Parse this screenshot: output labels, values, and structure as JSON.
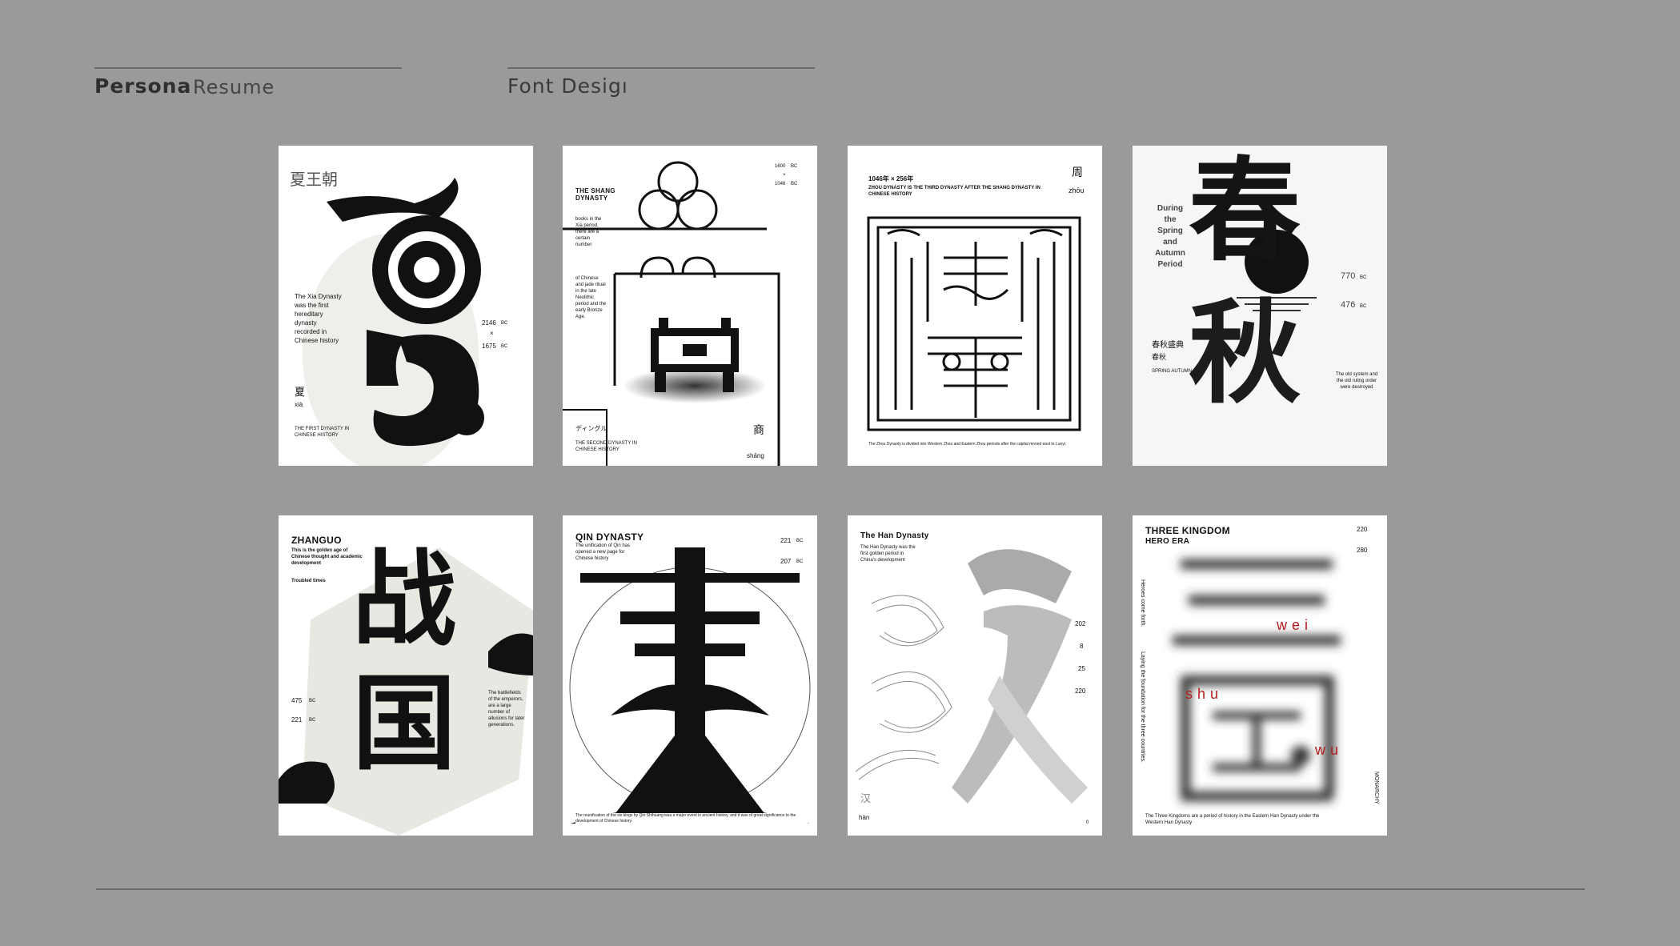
{
  "header": {
    "nav_persona": "Persona",
    "nav_resume": "Resume",
    "nav_font_design": "Font Desigı"
  },
  "posters": {
    "xia": {
      "glyph": "夏",
      "seal_text": "夏王朝",
      "body": "The Xia Dynasty was the first hereditary dynasty recorded in Chinese history",
      "years_start": "2146",
      "years_sep": "×",
      "years_end": "1675",
      "year_unit": "BC",
      "name_cn": "夏",
      "name_pinyin": "xià",
      "footer": "THE FIRST DYNASTY IN CHINESE HISTORY"
    },
    "shang": {
      "title": "THE SHANG DYNASTY",
      "years_start": "1600",
      "years_sep": "×",
      "years_end": "1046",
      "year_unit": "BC",
      "body_1": "books in the Xia period, there are a certain number",
      "body_2": "of Chinese and jade ritual in the late Neolithic period and the early Bronze Age.",
      "glyph": "商",
      "jp": "ディングル",
      "footer": "THE SECOND DYNASTY IN CHINESE HISTORY",
      "name_cn": "商",
      "name_pinyin": "shāng"
    },
    "zhou": {
      "years": "1046年 × 256年",
      "subtitle": "ZHOU DYNASTY IS THE THIRD DYNASTY AFTER THE SHANG DYNASTY IN CHINESE HISTORY",
      "name_cn": "周",
      "name_pinyin": "zhōu",
      "glyph": "周",
      "footer": "The Zhou Dynasty is divided into Western Zhou and Eastern Zhou periods after the capital moved east to Luoyi."
    },
    "chunqiu": {
      "glyph_top": "春",
      "glyph_bottom": "秋",
      "title": "During the Spring and Autumn Period",
      "years_start": "770",
      "years_end": "476",
      "year_unit": "BC",
      "seal_cn": "春秋盛典",
      "name_cn": "春秋",
      "name_en": "SPRING AUTUMN",
      "side": "The old system and the old ruling order were destroyed"
    },
    "zhanguo": {
      "title": "ZHANGUO",
      "body": "This is the golden age of Chinese thought and academic development",
      "sub": "Troubled times",
      "glyph_top": "战",
      "glyph_bottom": "国",
      "years_start": "475",
      "years_end": "221",
      "year_unit": "BC",
      "side": "The battlefields of the emperors, are a large number of allusions for later generations."
    },
    "qin": {
      "title": "QIN DYNASTY",
      "body": "The unification of Qin has opened a new page for Chinese history",
      "years_start": "221",
      "years_end": "207",
      "year_unit": "BC",
      "glyph": "秦",
      "footer": "The reunification of the six kings by Qin Shihuang was a major event in ancient history, and it was of great significance to the development of Chinese history."
    },
    "han": {
      "title": "The Han Dynasty",
      "body": "The Han Dynasty was the first golden period in China's development",
      "glyph": "汉",
      "years": [
        "202",
        "8",
        "25",
        "220"
      ],
      "name_cn": "汉",
      "name_pinyin": "hàn",
      "page": "0"
    },
    "sanguo": {
      "title": "THREE KINGDOM",
      "subtitle": "HERO ERA",
      "years_start": "220",
      "years_end": "280",
      "glyph": "三国",
      "wei": "wei",
      "shu": "shu",
      "wu": "wu",
      "side_left": "Heroes come forth.",
      "side_mid": "Laying the foundation for the three countries.",
      "side_right": "MONARCHY",
      "footer": "The Three Kingdoms are a period of history in the Eastern Han Dynasty under the Western Han Dynasty"
    }
  },
  "colors": {
    "background": "#9a9a9a",
    "rule": "#6a6a6a",
    "poster": "#ffffff",
    "accent_red": "#b51d1d"
  }
}
